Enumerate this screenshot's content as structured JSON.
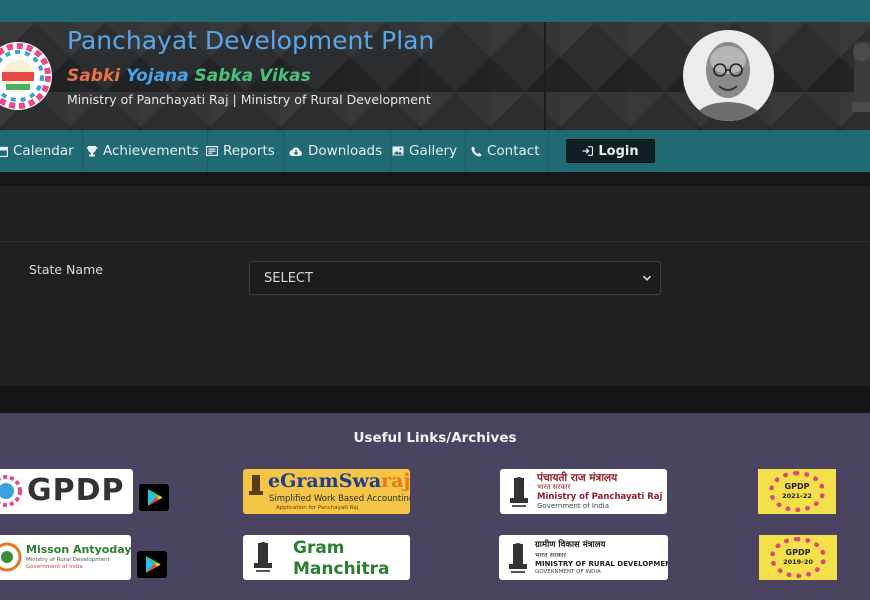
{
  "header": {
    "title": "Panchayat Development Plan",
    "tagline": {
      "part1": "Sabki",
      "part2": "Yojana",
      "part3": "Sabka Vikas"
    },
    "ministries": "Ministry of Panchayati Raj | Ministry of Rural Development",
    "colors": {
      "title": "#5ba6e8",
      "tag1": "#e8734a",
      "tag2": "#4aa3e8",
      "tag3": "#49c27c"
    }
  },
  "nav": {
    "items": [
      {
        "label": "Calendar",
        "icon": "calendar-icon"
      },
      {
        "label": "Achievements",
        "icon": "trophy-icon"
      },
      {
        "label": "Reports",
        "icon": "reports-icon"
      },
      {
        "label": "Downloads",
        "icon": "cloud-download-icon"
      },
      {
        "label": "Gallery",
        "icon": "image-icon"
      },
      {
        "label": "Contact",
        "icon": "phone-icon"
      }
    ],
    "login_label": "Login"
  },
  "form": {
    "state_label": "State Name",
    "state_select_value": "SELECT"
  },
  "footer": {
    "title": "Useful Links/Archives",
    "links": {
      "gpdp": "GPDP",
      "egramswaraj_a": "eGramSwa",
      "egramswaraj_b": "raj",
      "egramswaraj_sub": "Simplified Work Based Accounting",
      "egramswaraj_sub2": "Application for Panchayati Raj",
      "mopr_hindi": "पंचायती राज मंत्रालय",
      "mopr_hindi2": "भारत सरकार",
      "mopr_en": "Ministry of Panchayati Raj",
      "mopr_gov": "Government of India",
      "gpdp_2122_a": "GPDP",
      "gpdp_2122_b": "2021-22",
      "antyodaya": "Misson Antyodaya",
      "antyodaya_sub": "Ministry of Rural Development",
      "antyodaya_gov": "Government of India",
      "manchitra_1": "Gram",
      "manchitra_2": "Manchitra",
      "mord_hindi": "ग्रामीण विकास मंत्रालय",
      "mord_hindi2": "भारत सरकार",
      "mord_en": "MINISTRY OF RURAL DEVELOPMENT",
      "mord_gov": "GOVERNMENT OF INDIA",
      "gpdp_1920_a": "GPDP",
      "gpdp_1920_b": "2019-20"
    }
  }
}
